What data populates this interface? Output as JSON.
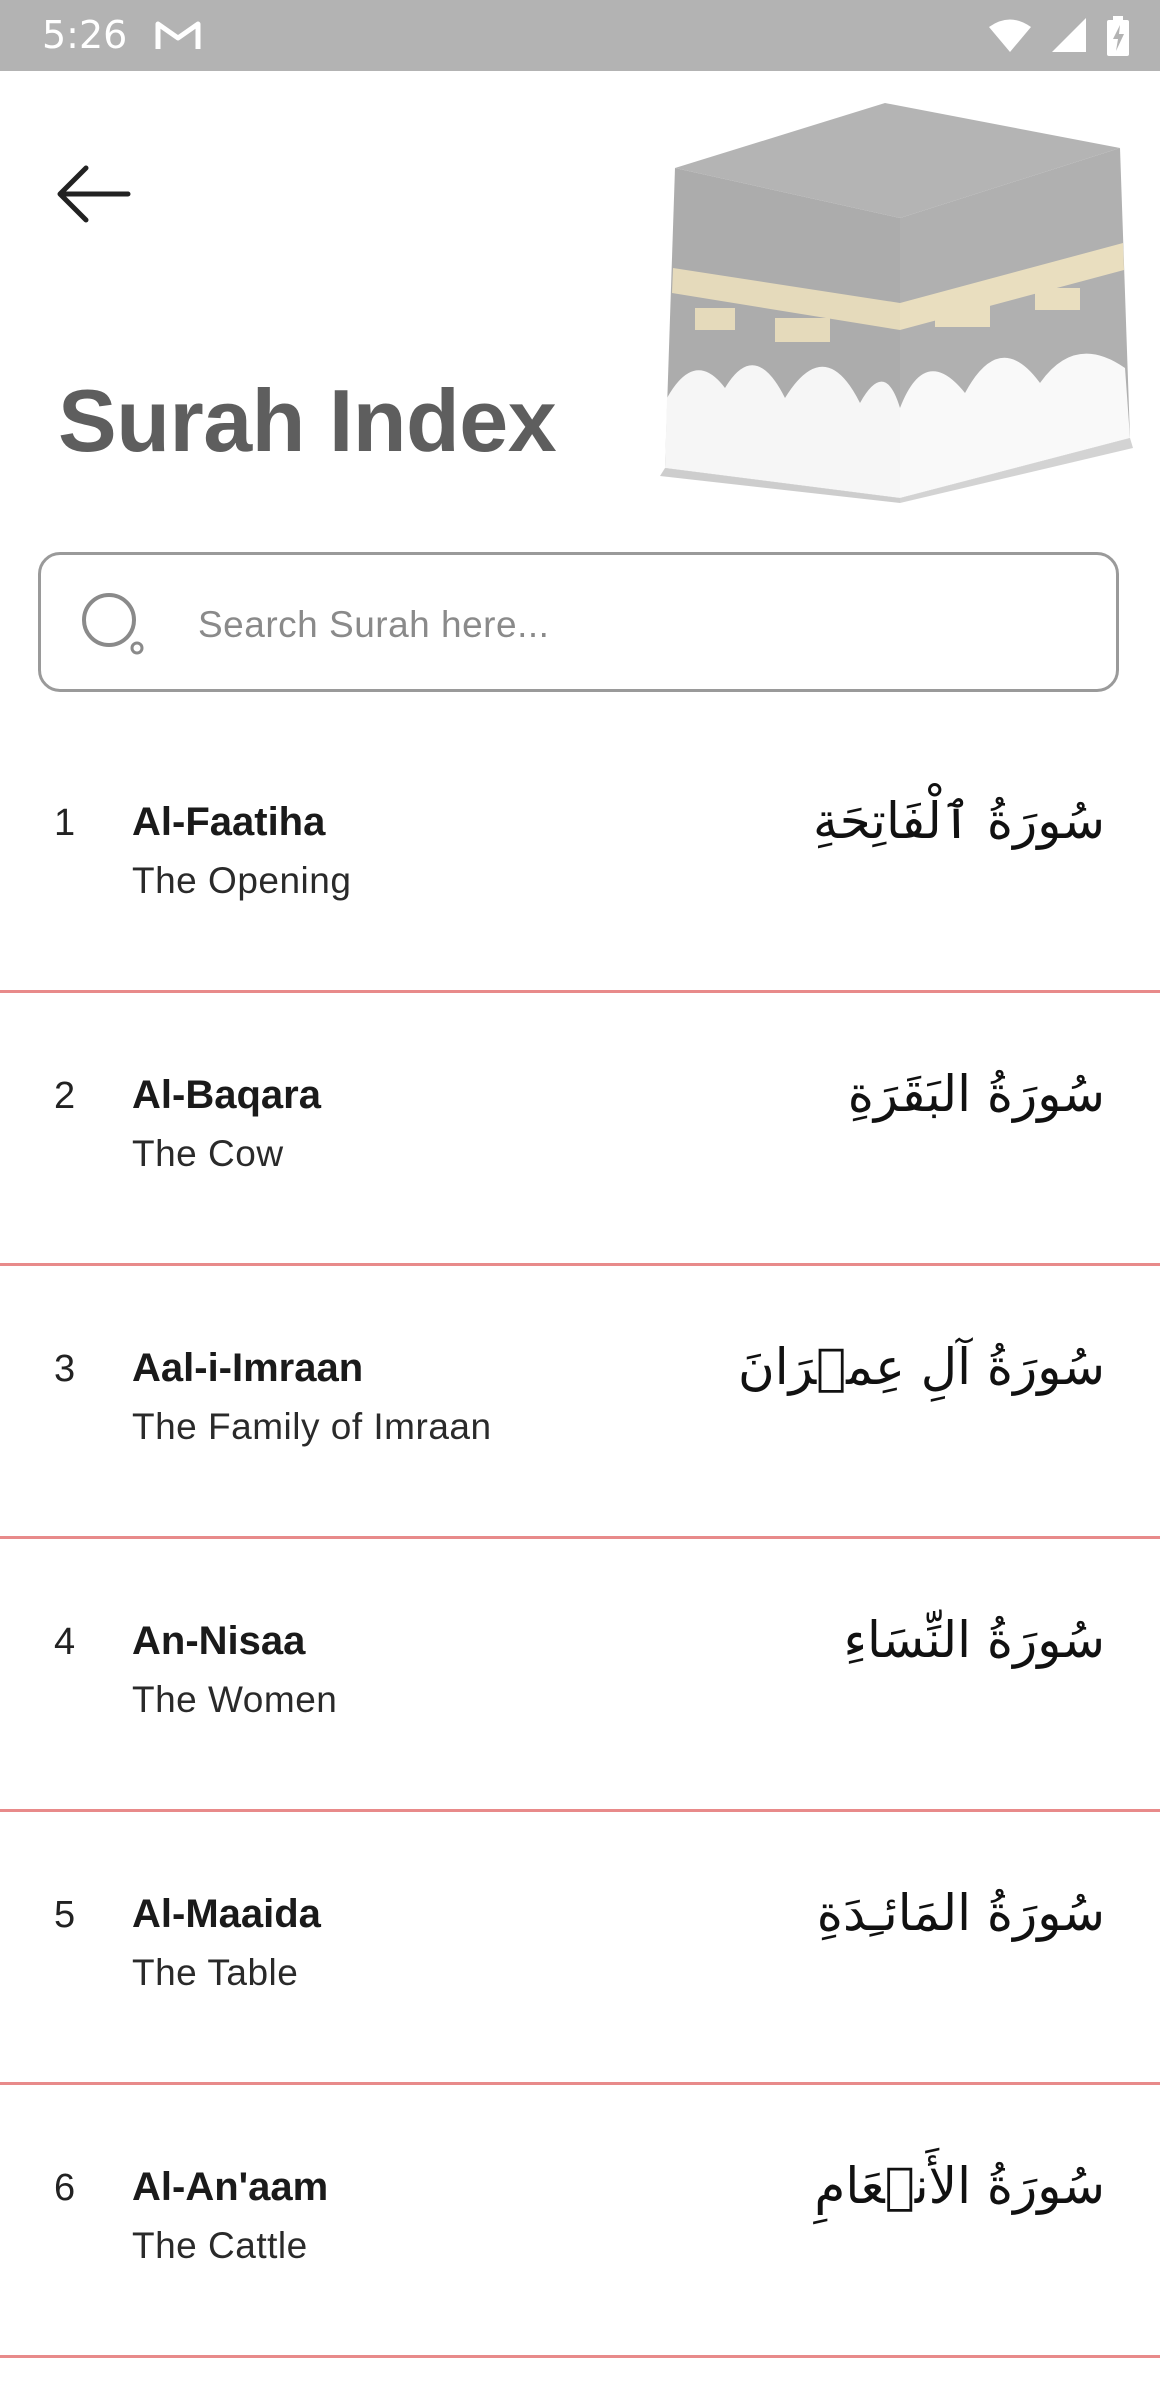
{
  "status_bar": {
    "time": "5:26",
    "icons": [
      "gmail-icon",
      "wifi-icon",
      "signal-icon",
      "battery-icon"
    ]
  },
  "header": {
    "back_icon": "arrow-left-icon",
    "title": "Surah Index",
    "hero_image": "kaaba-image"
  },
  "search": {
    "placeholder": "Search Surah here...",
    "value": "",
    "icon": "search-icon"
  },
  "colors": {
    "status_bar": "#b3b3b3",
    "title": "#5e5e5e",
    "divider": "#e88a8a",
    "search_border": "#9a9a9a"
  },
  "surahs": [
    {
      "number": "1",
      "name": "Al-Faatiha",
      "meaning": "The Opening",
      "arabic": "سُورَةُ ٱلْفَاتِحَةِ"
    },
    {
      "number": "2",
      "name": "Al-Baqara",
      "meaning": "The Cow",
      "arabic": "سُورَةُ البَقَرَةِ"
    },
    {
      "number": "3",
      "name": "Aal-i-Imraan",
      "meaning": "The Family of Imraan",
      "arabic": "سُورَةُ آلِ عِمۡرَانَ"
    },
    {
      "number": "4",
      "name": "An-Nisaa",
      "meaning": "The Women",
      "arabic": "سُورَةُ النِّسَاءِ"
    },
    {
      "number": "5",
      "name": "Al-Maaida",
      "meaning": "The Table",
      "arabic": "سُورَةُ المَائـِدَةِ"
    },
    {
      "number": "6",
      "name": "Al-An'aam",
      "meaning": "The Cattle",
      "arabic": "سُورَةُ الأَنۡعَامِ"
    }
  ]
}
